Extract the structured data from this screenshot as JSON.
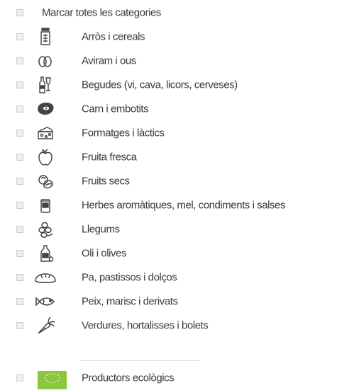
{
  "filter": {
    "select_all_label": "Marcar totes les categories",
    "categories": [
      {
        "label": "Arròs i cereals",
        "icon": "grain-jar-icon"
      },
      {
        "label": "Aviram i ous",
        "icon": "eggs-icon"
      },
      {
        "label": "Begudes (vi, cava, licors, cerveses)",
        "icon": "bottles-icon"
      },
      {
        "label": "Carn i embotits",
        "icon": "steak-icon"
      },
      {
        "label": "Formatges i làctics",
        "icon": "cheese-icon"
      },
      {
        "label": "Fruita fresca",
        "icon": "apple-icon"
      },
      {
        "label": "Fruits secs",
        "icon": "nuts-icon"
      },
      {
        "label": "Herbes aromàtiques, mel, condiments i salses",
        "icon": "spice-jar-icon"
      },
      {
        "label": "Llegums",
        "icon": "legumes-icon"
      },
      {
        "label": "Oli i olives",
        "icon": "oil-bottle-icon"
      },
      {
        "label": "Pa, pastissos i dolços",
        "icon": "bread-icon"
      },
      {
        "label": "Peix, marisc i derivats",
        "icon": "fish-icon"
      },
      {
        "label": "Verdures, hortalisses i bolets",
        "icon": "carrot-icon"
      }
    ],
    "organic": {
      "label": "Productors ecològics",
      "icon": "eu-organic-leaf-icon",
      "color": "#8cc63f"
    }
  },
  "colors": {
    "text": "#3a3a3a",
    "icon_stroke": "#444444",
    "checkbox_border": "#c9c9c9",
    "checkbox_fill": "#efefef",
    "divider": "#e1e1e1"
  }
}
